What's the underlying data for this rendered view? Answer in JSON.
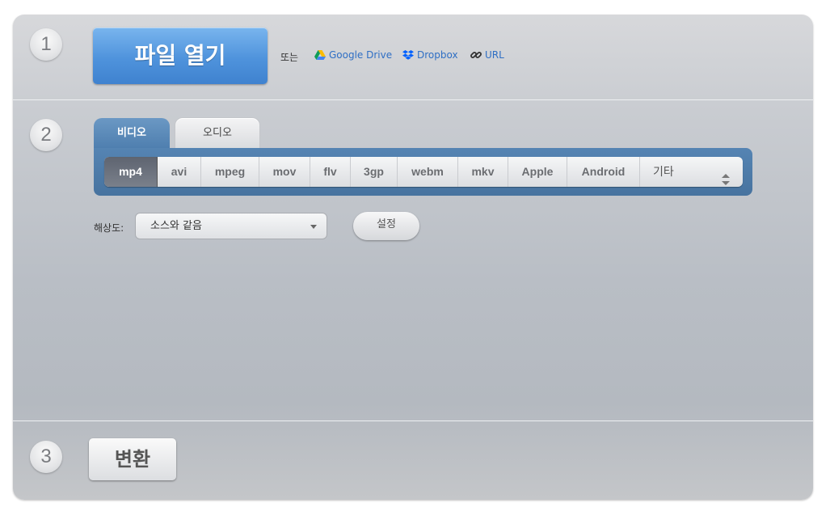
{
  "steps": [
    "1",
    "2",
    "3"
  ],
  "open_button": "파일 열기",
  "or_text": "또는",
  "sources": [
    {
      "label": "Google Drive",
      "icon": "google-drive-icon"
    },
    {
      "label": "Dropbox",
      "icon": "dropbox-icon"
    },
    {
      "label": "URL",
      "icon": "link-icon"
    }
  ],
  "tabs": [
    {
      "label": "비디오",
      "active": true
    },
    {
      "label": "오디오",
      "active": false
    }
  ],
  "formats": [
    "mp4",
    "avi",
    "mpeg",
    "mov",
    "flv",
    "3gp",
    "webm",
    "mkv",
    "Apple",
    "Android",
    "기타"
  ],
  "selected_format": "mp4",
  "resolution": {
    "label": "해상도:",
    "value": "소스와 같음"
  },
  "settings_button": "설정",
  "convert_button": "변환",
  "colors": {
    "accent_blue": "#4f93dc",
    "format_bar": "#4f7faf",
    "link": "#2f6fc4"
  }
}
